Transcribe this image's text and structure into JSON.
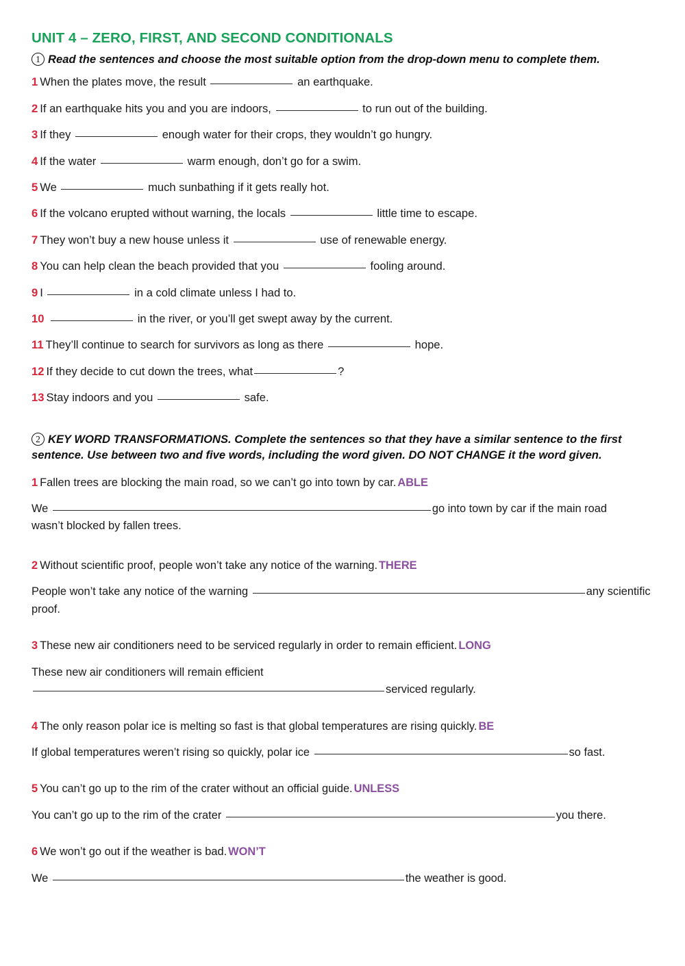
{
  "title": "UNIT 4 – ZERO, FIRST, AND SECOND CONDITIONALS",
  "colors": {
    "title_green": "#1aa159",
    "number_red": "#d8263b",
    "keyword_purple": "#8a4f9e",
    "text_black": "#1a1a1a",
    "page_background": "#ffffff"
  },
  "exercise1": {
    "marker": "1",
    "instructions": "Read the sentences and choose the most suitable option from the drop-down menu to complete them.",
    "items": [
      {
        "n": "1",
        "before": "When the plates move, the result",
        "after": "an earthquake."
      },
      {
        "n": "2",
        "before": "If an earthquake hits you and you are indoors,",
        "after": "to run out of the building."
      },
      {
        "n": "3",
        "before": "If they",
        "after": "enough water for their crops, they wouldn’t go hungry."
      },
      {
        "n": "4",
        "before": "If the water",
        "after": "warm enough, don’t go for a swim."
      },
      {
        "n": "5",
        "before": "We",
        "after": "much sunbathing if it gets really hot."
      },
      {
        "n": "6",
        "before": "If the volcano erupted without warning, the locals",
        "after": "little time to escape."
      },
      {
        "n": "7",
        "before": "They won’t buy a new house unless it",
        "after": "use of renewable energy."
      },
      {
        "n": "8",
        "before": "You can help clean the beach provided that you",
        "after": "fooling around."
      },
      {
        "n": "9",
        "before": "I",
        "after": "in a cold climate unless I had to."
      },
      {
        "n": "10",
        "before": "",
        "after": "in the river, or you’ll get swept away by the current."
      },
      {
        "n": "11",
        "before": "They’ll continue to search for survivors as long as there",
        "after": "hope."
      },
      {
        "n": "12",
        "before": "If they decide to cut down the trees, what",
        "after": "?"
      },
      {
        "n": "13",
        "before": "Stay indoors and you",
        "after": "safe."
      }
    ]
  },
  "exercise2": {
    "marker": "2",
    "instructions_line1": "KEY WORD TRANSFORMATIONS. Complete the sentences so that they have a similar sentence to the first",
    "instructions_line2": "sentence. Use between two and five words, including the word given. DO NOT CHANGE it the word given.",
    "items": [
      {
        "n": "1",
        "prompt": "Fallen trees are blocking the main road, so we can’t go into town by car.",
        "keyword": "ABLE",
        "answer_before": "We",
        "answer_after": "go into town by car if the main road",
        "answer_line2": "wasn’t blocked by fallen trees."
      },
      {
        "n": "2",
        "prompt": "Without scientific proof, people won’t take any notice of the warning.",
        "keyword": "THERE",
        "answer_before": "People won’t take any notice of the warning",
        "answer_after": "any scientific proof.",
        "answer_line2": ""
      },
      {
        "n": "3",
        "prompt": "These new air conditioners need to be serviced regularly in order to remain efficient.",
        "keyword": "LONG",
        "answer_before": "These new air conditioners will remain efficient",
        "answer_after": "serviced regularly.",
        "answer_line2": ""
      },
      {
        "n": "4",
        "prompt": "The only reason polar ice is melting so fast is that global temperatures are rising quickly.",
        "keyword": "BE",
        "answer_before": "If global temperatures weren’t rising so quickly, polar ice",
        "answer_after": "so fast.",
        "answer_line2": ""
      },
      {
        "n": "5",
        "prompt": "You can’t go up to the rim of the crater without an official guide.",
        "keyword": "UNLESS",
        "answer_before": "You can’t go up to the rim of the crater",
        "answer_after": "you there.",
        "answer_line2": ""
      },
      {
        "n": "6",
        "prompt": "We won’t go out if the weather is bad.",
        "keyword": "WON’T",
        "answer_before": "We",
        "answer_after": "the weather is good.",
        "answer_line2": ""
      }
    ]
  }
}
